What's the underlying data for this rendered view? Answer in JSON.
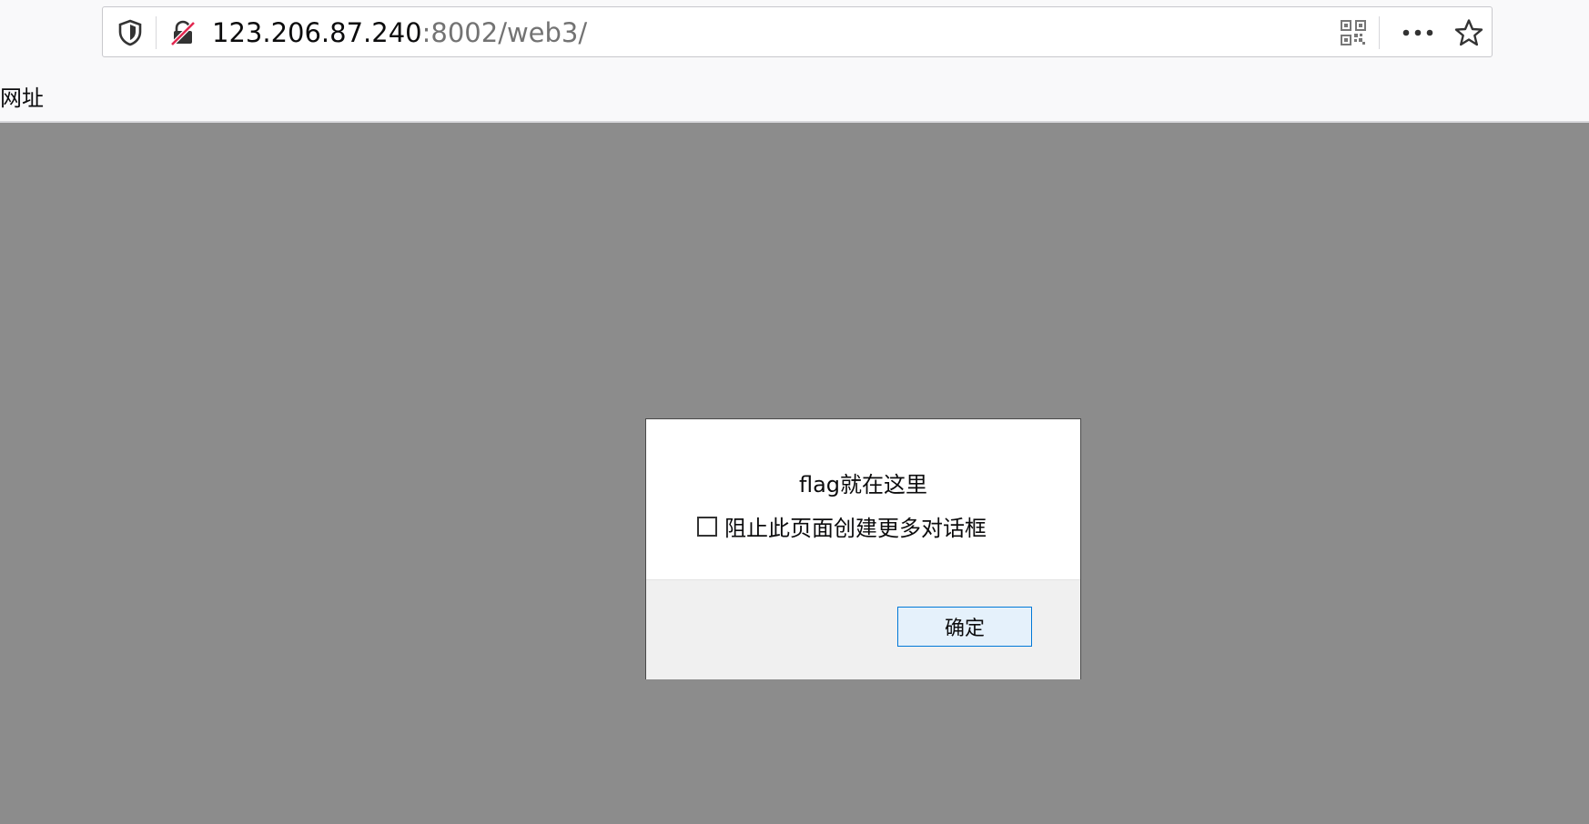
{
  "browser": {
    "url_host": "123.206.87.240",
    "url_rest": ":8002/web3/",
    "bookmarks_label": "网址",
    "icons": {
      "tracking_protection": "shield-icon",
      "connection": "insecure-lock-icon",
      "qr": "qr-code-icon",
      "page_actions": "more-dots-icon",
      "bookmark": "star-icon"
    }
  },
  "dialog": {
    "message": "flag就在这里",
    "checkbox_label": "阻止此页面创建更多对话框",
    "checkbox_checked": false,
    "ok_label": "确定"
  },
  "colors": {
    "overlay": "#8c8c8c",
    "button_border": "#0078d7",
    "button_bg": "#e5f1fb",
    "insecure_slash": "#e22850"
  }
}
